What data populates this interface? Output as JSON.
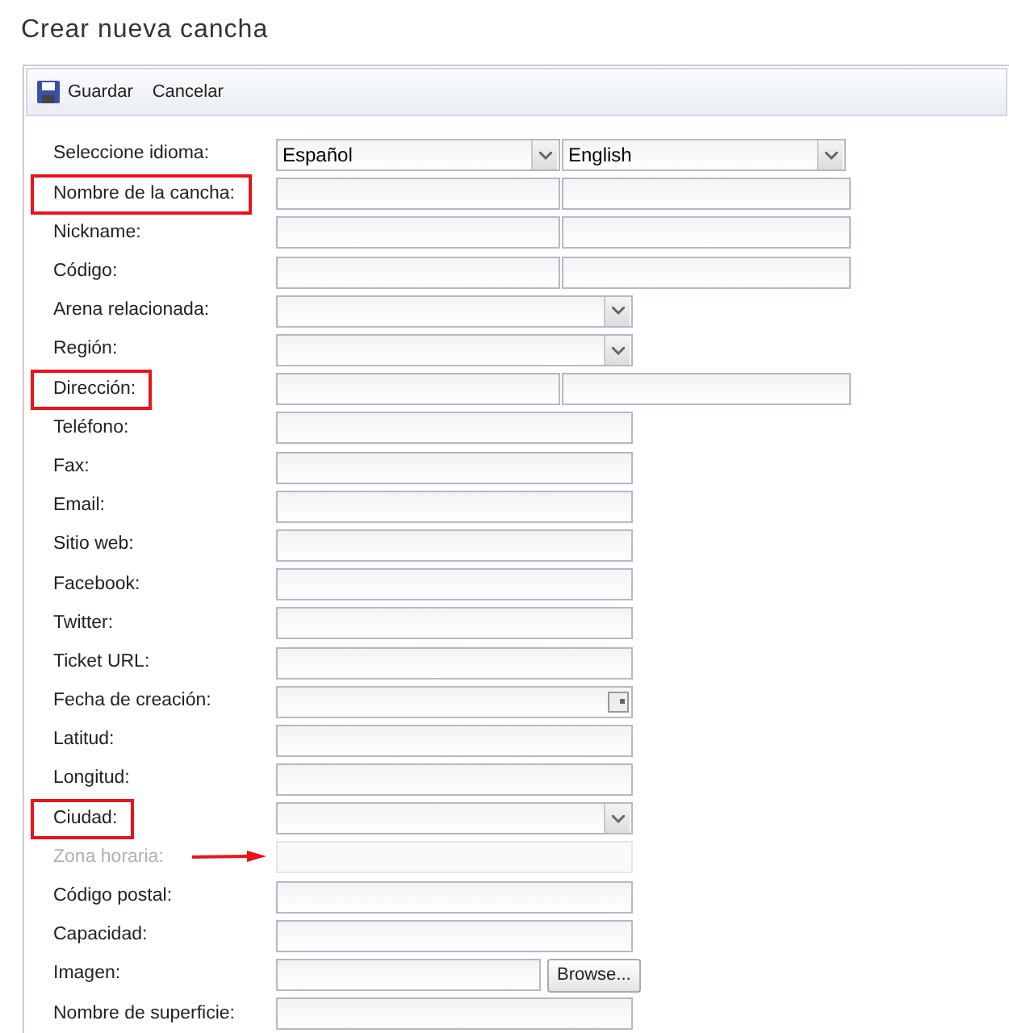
{
  "title": "Crear nueva cancha",
  "toolbar": [
    {
      "kind": "save",
      "label": "Guardar"
    },
    {
      "kind": "plain",
      "label": "Cancelar"
    }
  ],
  "fields": [
    {
      "label": "Seleccione idioma:",
      "kind": "select-pair",
      "values": [
        "Español",
        "English"
      ],
      "highlighted": false,
      "disabled": false,
      "pointed": false
    },
    {
      "label": "Nombre de la cancha:",
      "kind": "text-pair",
      "highlighted": true,
      "disabled": false,
      "pointed": false
    },
    {
      "label": "Nickname:",
      "kind": "text-pair",
      "highlighted": false,
      "disabled": false,
      "pointed": false
    },
    {
      "label": "Código:",
      "kind": "text-pair",
      "highlighted": false,
      "disabled": false,
      "pointed": false
    },
    {
      "label": "Arena relacionada:",
      "kind": "select",
      "highlighted": false,
      "disabled": false,
      "pointed": false
    },
    {
      "label": "Región:",
      "kind": "select",
      "highlighted": false,
      "disabled": false,
      "pointed": false
    },
    {
      "label": "Dirección:",
      "kind": "text-pair",
      "highlighted": true,
      "disabled": false,
      "pointed": false
    },
    {
      "label": "Teléfono:",
      "kind": "text",
      "highlighted": false,
      "disabled": false,
      "pointed": false
    },
    {
      "label": "Fax:",
      "kind": "text",
      "highlighted": false,
      "disabled": false,
      "pointed": false
    },
    {
      "label": "Email:",
      "kind": "text",
      "highlighted": false,
      "disabled": false,
      "pointed": false
    },
    {
      "label": "Sitio web:",
      "kind": "text",
      "highlighted": false,
      "disabled": false,
      "pointed": false
    },
    {
      "label": "Facebook:",
      "kind": "text",
      "highlighted": false,
      "disabled": false,
      "pointed": false
    },
    {
      "label": "Twitter:",
      "kind": "text",
      "highlighted": false,
      "disabled": false,
      "pointed": false
    },
    {
      "label": "Ticket URL:",
      "kind": "text",
      "highlighted": false,
      "disabled": false,
      "pointed": false
    },
    {
      "label": "Fecha de creación:",
      "kind": "date",
      "highlighted": false,
      "disabled": false,
      "pointed": false
    },
    {
      "label": "Latitud:",
      "kind": "text",
      "highlighted": false,
      "disabled": false,
      "pointed": false
    },
    {
      "label": "Longitud:",
      "kind": "text",
      "highlighted": false,
      "disabled": false,
      "pointed": false
    },
    {
      "label": "Ciudad:",
      "kind": "select",
      "highlighted": true,
      "disabled": false,
      "pointed": false
    },
    {
      "label": "Zona horaria:",
      "kind": "text",
      "highlighted": false,
      "disabled": true,
      "pointed": true
    },
    {
      "label": "Código postal:",
      "kind": "text",
      "highlighted": false,
      "disabled": false,
      "pointed": false
    },
    {
      "label": "Capacidad:",
      "kind": "text",
      "highlighted": false,
      "disabled": false,
      "pointed": false
    },
    {
      "label": "Imagen:",
      "kind": "file",
      "button": "Browse...",
      "highlighted": false,
      "disabled": false,
      "pointed": false
    },
    {
      "label": "Nombre de superficie:",
      "kind": "text",
      "highlighted": false,
      "disabled": false,
      "pointed": false
    }
  ]
}
